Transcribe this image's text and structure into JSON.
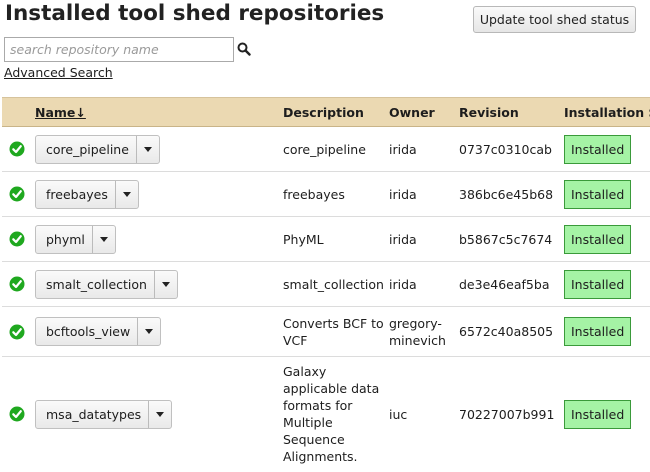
{
  "header": {
    "title": "Installed tool shed repositories",
    "update_button": "Update tool shed status"
  },
  "search": {
    "placeholder": "search repository name",
    "advanced_link": "Advanced Search"
  },
  "table": {
    "columns": [
      "Name↓",
      "Description",
      "Owner",
      "Revision",
      "Installation S"
    ],
    "rows": [
      {
        "name": "core_pipeline",
        "description": "core_pipeline",
        "owner": "irida",
        "revision": "0737c0310cab",
        "status": "Installed"
      },
      {
        "name": "freebayes",
        "description": "freebayes",
        "owner": "irida",
        "revision": "386bc6e45b68",
        "status": "Installed"
      },
      {
        "name": "phyml",
        "description": "PhyML",
        "owner": "irida",
        "revision": "b5867c5c7674",
        "status": "Installed"
      },
      {
        "name": "smalt_collection",
        "description": "smalt_collection",
        "owner": "irida",
        "revision": "de3e46eaf5ba",
        "status": "Installed"
      },
      {
        "name": "bcftools_view",
        "description": "Converts BCF to VCF",
        "owner": "gregory-minevich",
        "revision": "6572c40a8505",
        "status": "Installed"
      },
      {
        "name": "msa_datatypes",
        "description": "Galaxy applicable data formats for Multiple Sequence Alignments.",
        "owner": "iuc",
        "revision": "70227007b991",
        "status": "Installed"
      }
    ]
  },
  "colors": {
    "header_bg": "#ebd9b2",
    "installed_bg": "#a5f3a5",
    "check_green": "#1fa81f"
  },
  "icons": {
    "search": "search-icon",
    "status": "check-circle-icon",
    "row_menu": "caret-down-icon"
  }
}
